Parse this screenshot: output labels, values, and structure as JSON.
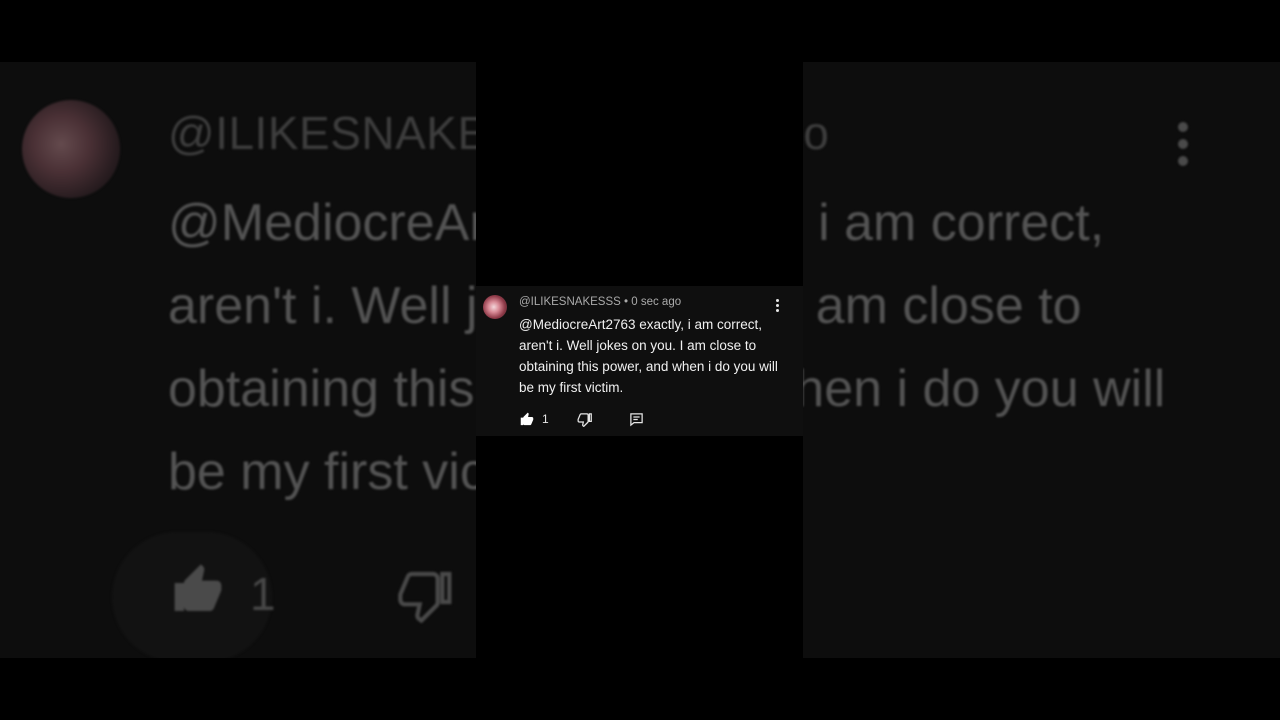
{
  "comment": {
    "handle": "@ILIKESNAKESSS",
    "separator": "•",
    "time": "0 sec ago",
    "text": "@MediocreArt2763 exactly, i am correct, aren't i. Well jokes on you. I am close to obtaining this power, and when i do you will be my first victim.",
    "like_count": "1"
  },
  "icons": {
    "like": "thumb-up-icon",
    "dislike": "thumb-down-icon",
    "reply": "reply-comment-icon",
    "menu": "more-vertical-icon"
  },
  "colors": {
    "background": "#000000",
    "card": "#0f0f0f",
    "meta_text": "#aaaaaa",
    "body_text": "#f1f1f1"
  }
}
